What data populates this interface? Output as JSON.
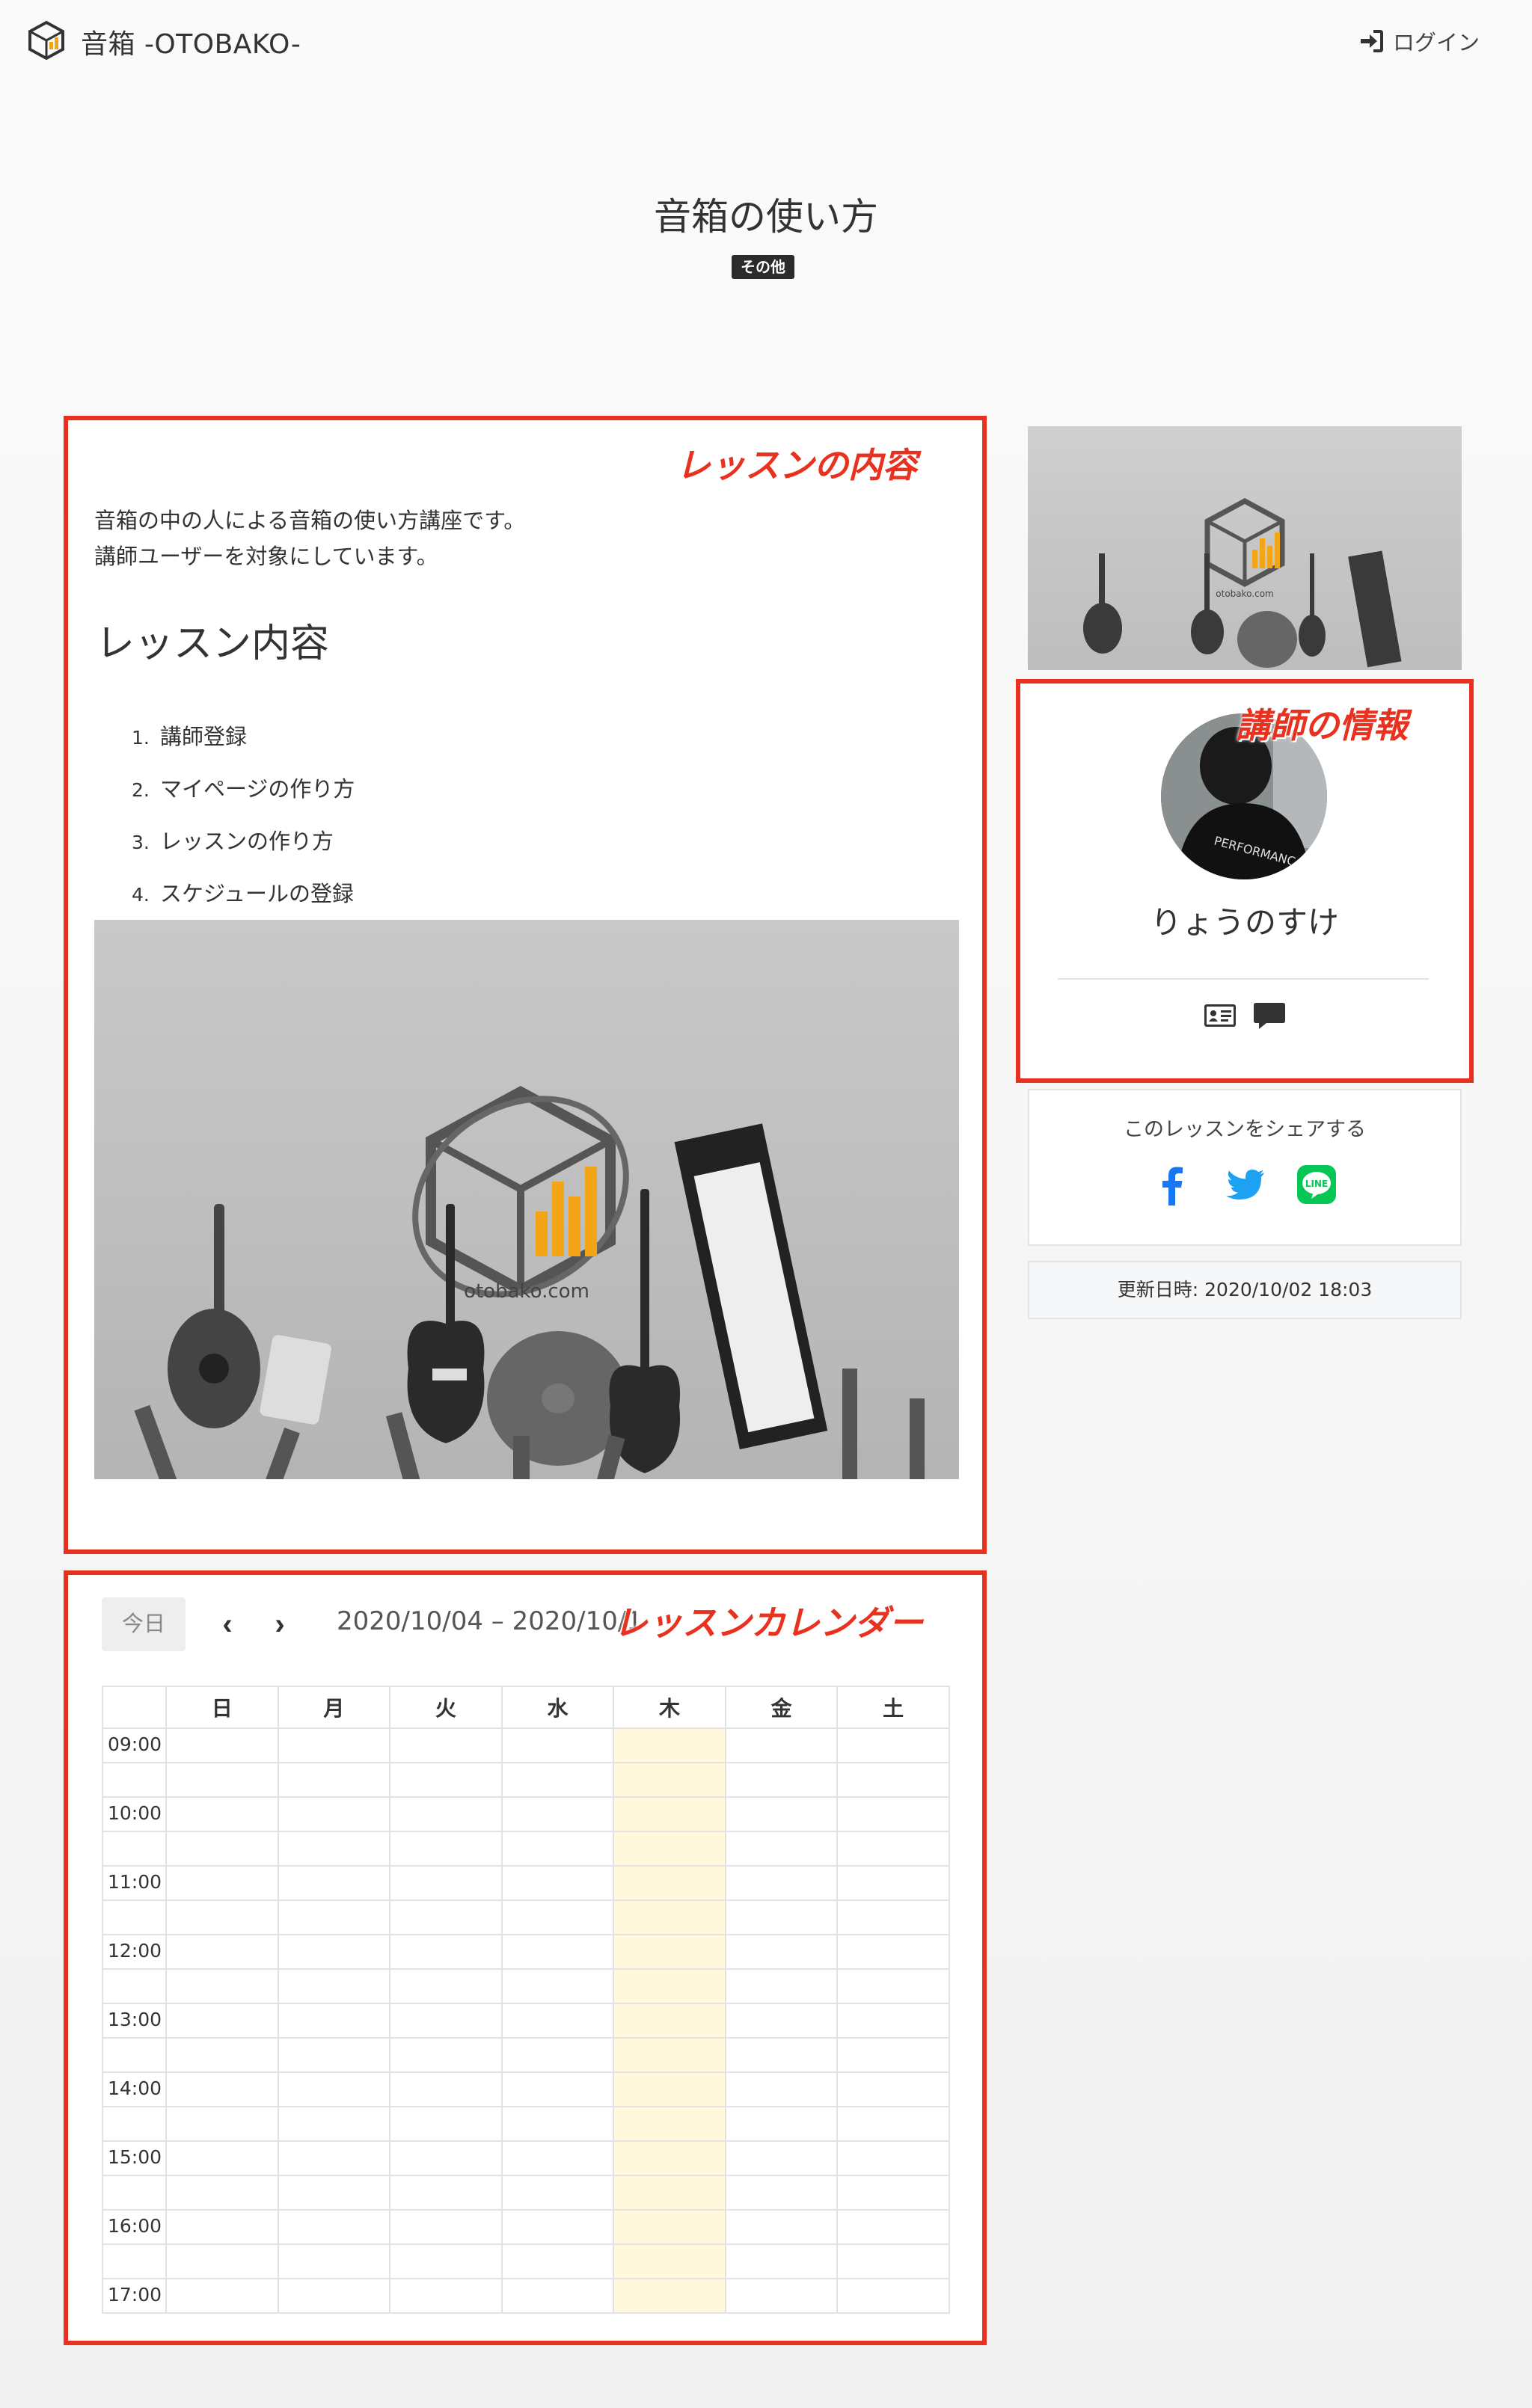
{
  "header": {
    "brand": "音箱 -OTOBAKO-",
    "login_label": "ログイン"
  },
  "lesson": {
    "title": "音箱の使い方",
    "category": "その他",
    "intro_line1": "音箱の中の人による音箱の使い方講座です。",
    "intro_line2": "講師ユーザーを対象にしています。",
    "section_heading": "レッスン内容",
    "items": [
      {
        "num": "1.",
        "label": "講師登録"
      },
      {
        "num": "2.",
        "label": "マイページの作り方"
      },
      {
        "num": "3.",
        "label": "レッスンの作り方"
      },
      {
        "num": "4.",
        "label": "スケジュールの登録"
      }
    ],
    "hero_caption": "otobako.com"
  },
  "annotations": {
    "content": "レッスンの内容",
    "teacher": "講師の情報",
    "calendar": "レッスンカレンダー"
  },
  "calendar": {
    "today_label": "今日",
    "prev_label": "‹",
    "next_label": "›",
    "range": "2020/10/04 – 2020/10/1",
    "days": [
      "日",
      "月",
      "火",
      "水",
      "木",
      "金",
      "土"
    ],
    "times": [
      "09:00",
      "10:00",
      "11:00",
      "12:00",
      "13:00",
      "14:00",
      "15:00",
      "16:00",
      "17:00"
    ],
    "highlight_day": "木",
    "highlight_color": "#fff8dc"
  },
  "sidebar": {
    "image_caption": "otobako.com",
    "teacher_name": "りょうのすけ",
    "teacher_icons": [
      "id-card-icon",
      "comment-icon"
    ],
    "share_title": "このレッスンをシェアする",
    "share_icons": [
      "facebook-icon",
      "twitter-icon",
      "line-icon"
    ],
    "updated": "更新日時: 2020/10/02 18:03"
  },
  "colors": {
    "annotation": "#e8311f",
    "accent_logo": "#f2a516",
    "facebook": "#1877f2",
    "twitter": "#1da1f2",
    "line": "#06c755"
  }
}
